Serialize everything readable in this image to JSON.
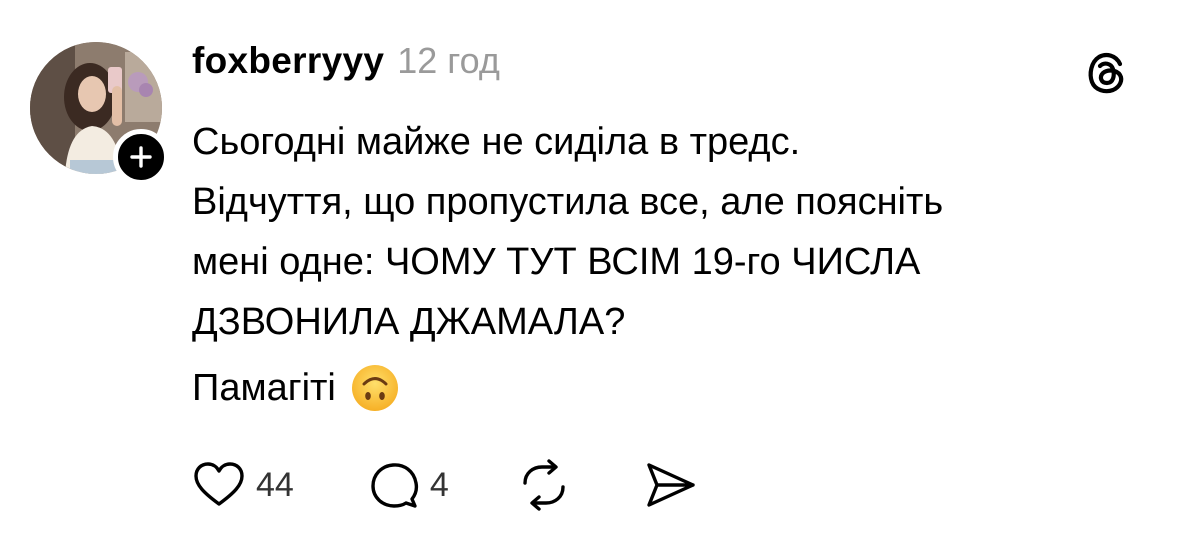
{
  "post": {
    "username": "foxberryyy",
    "timestamp": "12 год",
    "text_lines": [
      "Сьогодні майже не сиділа в тредс.",
      "Відчуття, що пропустила все, але поясніть",
      "мені одне: ЧОМУ ТУТ ВСІМ 19-го ЧИСЛА",
      "ДЗВОНИЛА ДЖАМАЛА?"
    ],
    "closing_text": "Памагіті",
    "closing_emoji": "upside-down-face",
    "likes": "44",
    "replies": "4"
  },
  "icons": {
    "like": "heart-icon",
    "reply": "speech-bubble-icon",
    "repost": "repost-icon",
    "share": "send-icon",
    "logo": "threads-logo-icon",
    "follow": "plus-icon"
  },
  "colors": {
    "text": "#000000",
    "muted": "#9a9a9a",
    "background": "#ffffff"
  }
}
